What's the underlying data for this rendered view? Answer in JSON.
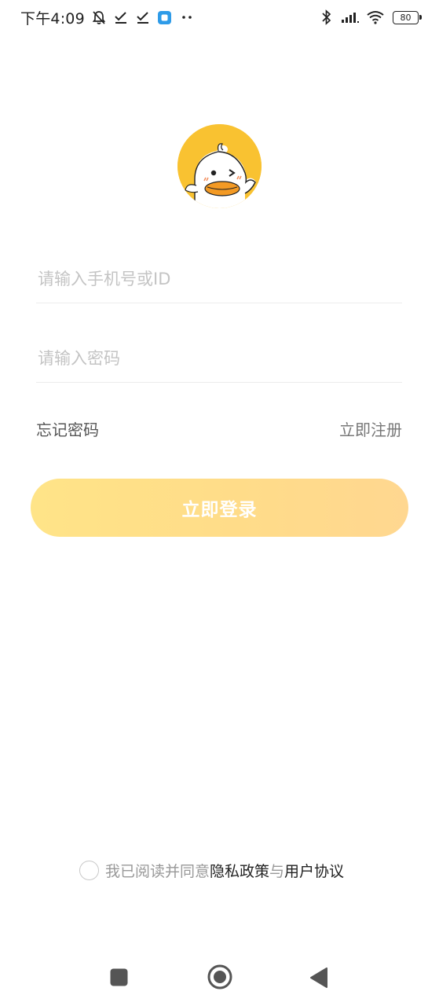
{
  "status_bar": {
    "time": "下午4:09",
    "battery_level": "80",
    "icons": [
      "alarm-off-icon",
      "task-done-icon",
      "task-done-icon",
      "app-notification-icon",
      "more-dots-icon",
      "bluetooth-icon",
      "signal-icon",
      "wifi-icon",
      "battery-icon"
    ]
  },
  "logo": {
    "icon": "duck-avatar-icon",
    "background_color": "#f9c231"
  },
  "login_form": {
    "phone_placeholder": "请输入手机号或ID",
    "phone_value": "",
    "password_placeholder": "请输入密码",
    "password_value": "",
    "forgot_password_label": "忘记密码",
    "register_label": "立即注册",
    "login_button_label": "立即登录"
  },
  "agreement": {
    "checked": false,
    "prefix": "我已阅读并同意",
    "privacy_label": "隐私政策",
    "connector": "与",
    "terms_label": "用户协议"
  },
  "colors": {
    "accent_gradient_start": "#ffe488",
    "accent_gradient_end": "#ffd790",
    "placeholder": "#c4c4c4"
  },
  "nav_bar": {
    "recent_icon": "square-recent-icon",
    "home_icon": "circle-home-icon",
    "back_icon": "triangle-back-icon"
  }
}
